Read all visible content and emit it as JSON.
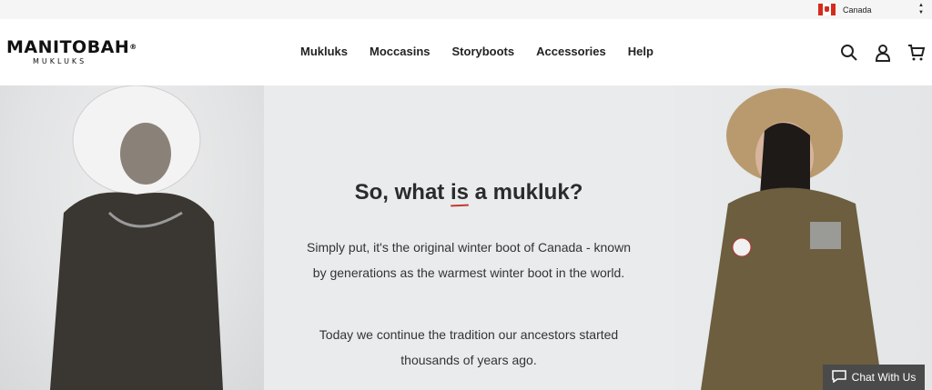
{
  "topbar": {
    "country": "Canada",
    "caret_up": "▲",
    "caret_down": "▼"
  },
  "header": {
    "logo_main": "MANITOBAH",
    "logo_registered": "®",
    "logo_sub": "MUKLUKS",
    "nav": [
      "Mukluks",
      "Moccasins",
      "Storyboots",
      "Accessories",
      "Help"
    ],
    "icons": [
      "search-icon",
      "account-icon",
      "cart-icon"
    ]
  },
  "hero": {
    "title_before": "So, what ",
    "title_emph": "is",
    "title_after": " a mukluk?",
    "paragraph1": "Simply put, it's the original winter boot of Canada - known by generations as the warmest winter boot in the world.",
    "paragraph2": "Today we continue the tradition our ancestors started thousands of years ago."
  },
  "chat": {
    "label": "Chat With Us"
  },
  "colors": {
    "accent_red": "#c23b2e",
    "hero_bg": "#e9ebed",
    "chat_bg": "#4a4a4a"
  }
}
